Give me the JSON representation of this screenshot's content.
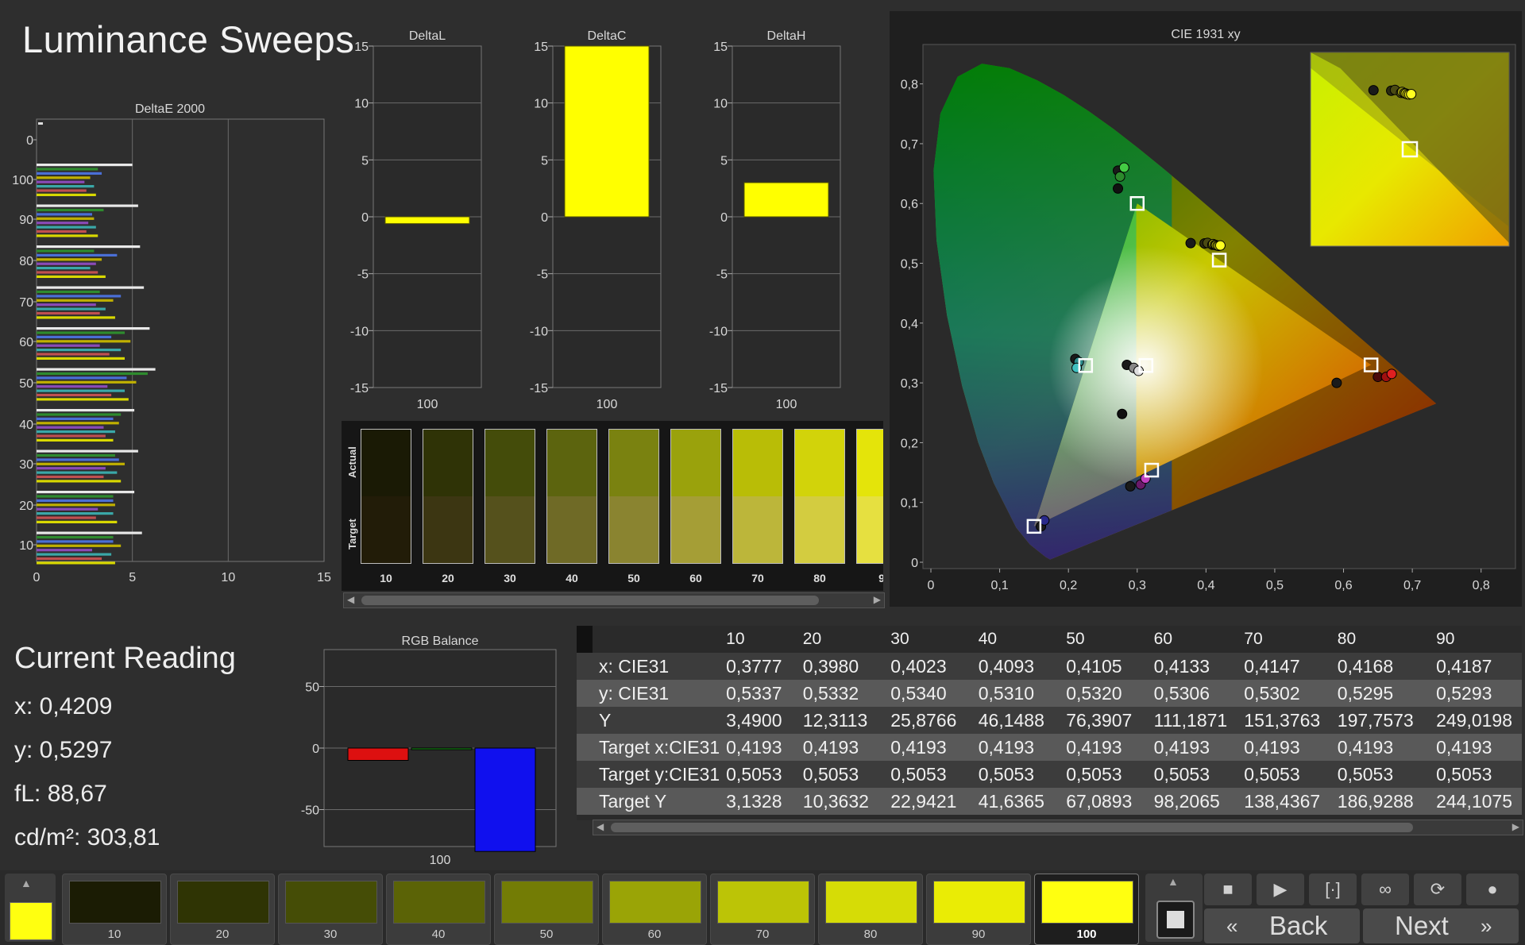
{
  "page_title": "Luminance Sweeps",
  "current_reading": {
    "title": "Current Reading",
    "x": "x: 0,4209",
    "y": "y: 0,5297",
    "fl": "fL: 88,67",
    "cdm2": "cd/m²: 303,81"
  },
  "swatch_strip": {
    "actual_label": "Actual",
    "target_label": "Target",
    "labels": [
      "10",
      "20",
      "30",
      "40",
      "50",
      "60",
      "70",
      "80",
      "9"
    ],
    "actual_colors": [
      "#1a1a05",
      "#2f3306",
      "#444c0a",
      "#5c640e",
      "#7a8210",
      "#9aa20c",
      "#b9bd06",
      "#d2d30a",
      "#e4e40a"
    ],
    "target_colors": [
      "#221c08",
      "#3c3612",
      "#55511c",
      "#6f6a26",
      "#8a8430",
      "#a59e36",
      "#bcb63a",
      "#d3cc40",
      "#e6e040"
    ]
  },
  "bottom_bar": {
    "tiles": [
      {
        "label": "10",
        "color": "#1b1c04"
      },
      {
        "label": "20",
        "color": "#2f3404"
      },
      {
        "label": "30",
        "color": "#454d06"
      },
      {
        "label": "40",
        "color": "#5b6306"
      },
      {
        "label": "50",
        "color": "#737c05"
      },
      {
        "label": "60",
        "color": "#9aa406"
      },
      {
        "label": "70",
        "color": "#bcc406"
      },
      {
        "label": "80",
        "color": "#d6dc06"
      },
      {
        "label": "90",
        "color": "#eaec05"
      },
      {
        "label": "100",
        "color": "#ffff10"
      }
    ],
    "back_label": "Back",
    "next_label": "Next"
  },
  "table": {
    "headers": [
      "",
      "10",
      "20",
      "30",
      "40",
      "50",
      "60",
      "70",
      "80",
      "90"
    ],
    "rows": [
      {
        "label": "x: CIE31",
        "values": [
          "0,3777",
          "0,3980",
          "0,4023",
          "0,4093",
          "0,4105",
          "0,4133",
          "0,4147",
          "0,4168",
          "0,4187"
        ]
      },
      {
        "label": "y: CIE31",
        "values": [
          "0,5337",
          "0,5332",
          "0,5340",
          "0,5310",
          "0,5320",
          "0,5306",
          "0,5302",
          "0,5295",
          "0,5293"
        ]
      },
      {
        "label": "Y",
        "values": [
          "3,4900",
          "12,3113",
          "25,8766",
          "46,1488",
          "76,3907",
          "111,1871",
          "151,3763",
          "197,7573",
          "249,0198"
        ]
      },
      {
        "label": "Target x:CIE31",
        "values": [
          "0,4193",
          "0,4193",
          "0,4193",
          "0,4193",
          "0,4193",
          "0,4193",
          "0,4193",
          "0,4193",
          "0,4193"
        ]
      },
      {
        "label": "Target y:CIE31",
        "values": [
          "0,5053",
          "0,5053",
          "0,5053",
          "0,5053",
          "0,5053",
          "0,5053",
          "0,5053",
          "0,5053",
          "0,5053"
        ]
      },
      {
        "label": "Target Y",
        "values": [
          "3,1328",
          "10,3632",
          "22,9421",
          "41,6365",
          "67,0893",
          "98,2065",
          "138,4367",
          "186,9288",
          "244,1075"
        ]
      }
    ]
  },
  "chart_data": [
    {
      "type": "bar",
      "title": "DeltaE 2000",
      "orientation": "horizontal",
      "xlim": [
        0,
        15
      ],
      "ylim": [
        0,
        100
      ],
      "xticks": [
        "0",
        "5",
        "10",
        "15"
      ],
      "yticks": [
        "0",
        "100",
        "90",
        "80",
        "70",
        "60",
        "50",
        "40",
        "30",
        "20",
        "10"
      ],
      "groups": [
        {
          "level": 100,
          "values": [
            5.0,
            3.2,
            3.4,
            2.8,
            2.5,
            3.0,
            2.6,
            3.1
          ]
        },
        {
          "level": 90,
          "values": [
            5.3,
            3.5,
            2.9,
            3.0,
            2.7,
            3.1,
            2.6,
            3.2
          ]
        },
        {
          "level": 80,
          "values": [
            5.4,
            3.0,
            4.2,
            3.4,
            3.1,
            2.8,
            3.2,
            3.6
          ]
        },
        {
          "level": 70,
          "values": [
            5.6,
            3.3,
            4.4,
            4.0,
            3.1,
            3.6,
            3.3,
            4.1
          ]
        },
        {
          "level": 60,
          "values": [
            5.9,
            4.6,
            3.9,
            4.9,
            3.3,
            4.4,
            3.8,
            4.6
          ]
        },
        {
          "level": 50,
          "values": [
            6.2,
            5.8,
            4.7,
            5.2,
            3.7,
            4.6,
            3.9,
            4.8
          ]
        },
        {
          "level": 40,
          "values": [
            5.1,
            4.4,
            4.0,
            4.3,
            3.5,
            4.1,
            3.6,
            4.0
          ]
        },
        {
          "level": 30,
          "values": [
            5.3,
            4.1,
            4.3,
            4.6,
            3.6,
            4.2,
            3.5,
            4.4
          ]
        },
        {
          "level": 20,
          "values": [
            5.1,
            4.0,
            4.0,
            4.1,
            3.2,
            4.0,
            3.1,
            4.2
          ]
        },
        {
          "level": 10,
          "values": [
            5.5,
            4.0,
            4.0,
            4.4,
            2.9,
            3.9,
            3.4,
            4.1
          ]
        }
      ],
      "bar_colors": [
        "#e8e8e8",
        "#2e8b2e",
        "#4a6fd6",
        "#c0b000",
        "#8a4ab8",
        "#3aa8a8",
        "#c05050",
        "#d8d800"
      ]
    },
    {
      "type": "bar",
      "title": "DeltaL",
      "categories": [
        "100"
      ],
      "values": [
        -0.6
      ],
      "ylim": [
        -15,
        15
      ],
      "yticks": [
        "15",
        "10",
        "5",
        "0",
        "-5",
        "-10",
        "-15"
      ]
    },
    {
      "type": "bar",
      "title": "DeltaC",
      "categories": [
        "100"
      ],
      "values": [
        15
      ],
      "ylim": [
        -15,
        15
      ],
      "yticks": [
        "15",
        "10",
        "5",
        "0",
        "-5",
        "-10",
        "-15"
      ]
    },
    {
      "type": "bar",
      "title": "DeltaH",
      "categories": [
        "100"
      ],
      "values": [
        3
      ],
      "ylim": [
        -15,
        15
      ],
      "yticks": [
        "15",
        "10",
        "5",
        "0",
        "-5",
        "-10",
        "-15"
      ]
    },
    {
      "type": "bar",
      "title": "RGB Balance",
      "categories": [
        "100"
      ],
      "series": [
        {
          "color": "#dd1010",
          "value": -10
        },
        {
          "color": "#1a9a1a",
          "value": 0
        },
        {
          "color": "#1010ee",
          "value": -84
        }
      ],
      "ylim": [
        -80,
        80
      ],
      "yticks": [
        "50",
        "0",
        "-50"
      ]
    },
    {
      "type": "scatter",
      "title": "CIE 1931 xy",
      "xlim": [
        0,
        0.85
      ],
      "ylim": [
        0,
        0.85
      ],
      "xticks": [
        "0",
        "0,1",
        "0,2",
        "0,3",
        "0,4",
        "0,5",
        "0,6",
        "0,7",
        "0,8"
      ],
      "yticks": [
        "0",
        "0,1",
        "0,2",
        "0,3",
        "0,4",
        "0,5",
        "0,6",
        "0,7",
        "0,8"
      ],
      "gamut_triangle": [
        [
          0.3,
          0.6
        ],
        [
          0.64,
          0.33
        ],
        [
          0.15,
          0.06
        ]
      ],
      "targets": [
        [
          0.3,
          0.6
        ],
        [
          0.4193,
          0.5053
        ],
        [
          0.64,
          0.33
        ],
        [
          0.225,
          0.329
        ],
        [
          0.3127,
          0.329
        ],
        [
          0.321,
          0.154
        ],
        [
          0.15,
          0.06
        ]
      ],
      "measured": [
        {
          "x": 0.3777,
          "y": 0.5337,
          "color": "#1a1a1a"
        },
        {
          "x": 0.398,
          "y": 0.5332,
          "color": "#2a2a10"
        },
        {
          "x": 0.4023,
          "y": 0.534,
          "color": "#4a4a12"
        },
        {
          "x": 0.4093,
          "y": 0.531,
          "color": "#6a6a14"
        },
        {
          "x": 0.4105,
          "y": 0.532,
          "color": "#8a8a10"
        },
        {
          "x": 0.4133,
          "y": 0.5306,
          "color": "#aaaa10"
        },
        {
          "x": 0.4147,
          "y": 0.5302,
          "color": "#c8c810"
        },
        {
          "x": 0.4168,
          "y": 0.5295,
          "color": "#e0e010"
        },
        {
          "x": 0.4187,
          "y": 0.5293,
          "color": "#f0f010"
        },
        {
          "x": 0.4209,
          "y": 0.5297,
          "color": "#ffff20"
        },
        {
          "x": 0.272,
          "y": 0.655,
          "color": "#1a1a1a"
        },
        {
          "x": 0.275,
          "y": 0.645,
          "color": "#2c8a2c"
        },
        {
          "x": 0.281,
          "y": 0.66,
          "color": "#44cc44"
        },
        {
          "x": 0.272,
          "y": 0.625,
          "color": "#111111"
        },
        {
          "x": 0.59,
          "y": 0.3,
          "color": "#1a1a1a"
        },
        {
          "x": 0.65,
          "y": 0.31,
          "color": "#4a0a0a"
        },
        {
          "x": 0.662,
          "y": 0.31,
          "color": "#a01010"
        },
        {
          "x": 0.67,
          "y": 0.315,
          "color": "#e02020"
        },
        {
          "x": 0.21,
          "y": 0.34,
          "color": "#1a1a1a"
        },
        {
          "x": 0.215,
          "y": 0.335,
          "color": "#2a8a8a"
        },
        {
          "x": 0.212,
          "y": 0.325,
          "color": "#40c0c0"
        },
        {
          "x": 0.285,
          "y": 0.33,
          "color": "#1a1a1a"
        },
        {
          "x": 0.295,
          "y": 0.325,
          "color": "#888888"
        },
        {
          "x": 0.302,
          "y": 0.32,
          "color": "#dddddd"
        },
        {
          "x": 0.278,
          "y": 0.248,
          "color": "#111111"
        },
        {
          "x": 0.29,
          "y": 0.127,
          "color": "#1a1a1a"
        },
        {
          "x": 0.305,
          "y": 0.13,
          "color": "#6a1a6a"
        },
        {
          "x": 0.312,
          "y": 0.14,
          "color": "#c040c0"
        },
        {
          "x": 0.16,
          "y": 0.06,
          "color": "#1a1a1a"
        },
        {
          "x": 0.165,
          "y": 0.07,
          "color": "#2a2a8a"
        }
      ]
    }
  ]
}
